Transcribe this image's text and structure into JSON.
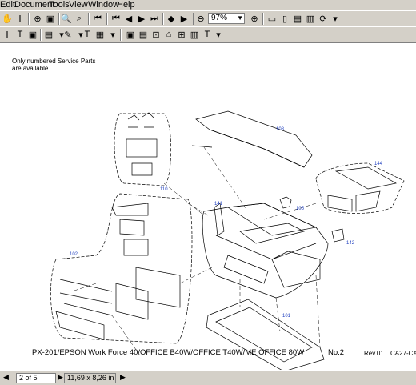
{
  "menu": {
    "items": [
      "Edit",
      "Document",
      "Tools",
      "View",
      "Window",
      "Help"
    ]
  },
  "toolbar": {
    "zoom_value": "97%"
  },
  "document": {
    "note_line1": "Only numbered Service Parts",
    "note_line2": "are available.",
    "footer_title": "PX-201/EPSON Work Force 40/OFFICE B40W/OFFICE T40W/ME OFFICE 80W",
    "footer_page": "No.2",
    "footer_rev": "Rev.01",
    "footer_code": "CA27-CA",
    "part_labels": [
      "108",
      "110",
      "144",
      "105",
      "141",
      "142",
      "102",
      "101"
    ]
  },
  "status": {
    "page_indicator": "2 of 5",
    "page_size": "11,69 x 8,26 in"
  }
}
